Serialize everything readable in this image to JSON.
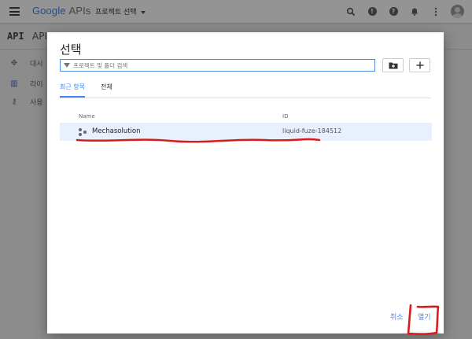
{
  "topbar": {
    "brand_google": "Google",
    "brand_apis": "APIs",
    "project_selector": "프로젝트 선택",
    "icons": [
      "search-icon",
      "alert-icon",
      "help-icon",
      "bell-icon",
      "more-icon",
      "avatar"
    ]
  },
  "background": {
    "api_mark": "API",
    "api_title": "API",
    "sidebar": [
      {
        "label": "대시",
        "icon": "dashboard-icon"
      },
      {
        "label": "라이",
        "icon": "library-icon"
      },
      {
        "label": "사용",
        "icon": "key-icon"
      }
    ]
  },
  "dialog": {
    "title": "선택",
    "search_placeholder": "프로젝트 및 폴더 검색",
    "new_folder_icon": "folder-add-icon",
    "add_icon": "plus-icon",
    "tabs": [
      {
        "label": "최근 항목",
        "active": true
      },
      {
        "label": "전체",
        "active": false
      }
    ],
    "columns": {
      "name": "Name",
      "id": "ID"
    },
    "rows": [
      {
        "name": "Mechasolution",
        "id": "liquid-fuze-184512",
        "selected": true
      }
    ],
    "cancel_label": "취소",
    "open_label": "열기"
  },
  "colors": {
    "accent": "#4285f4",
    "selected_row": "#e8f0fe",
    "annotation_red": "#d81c1c"
  }
}
